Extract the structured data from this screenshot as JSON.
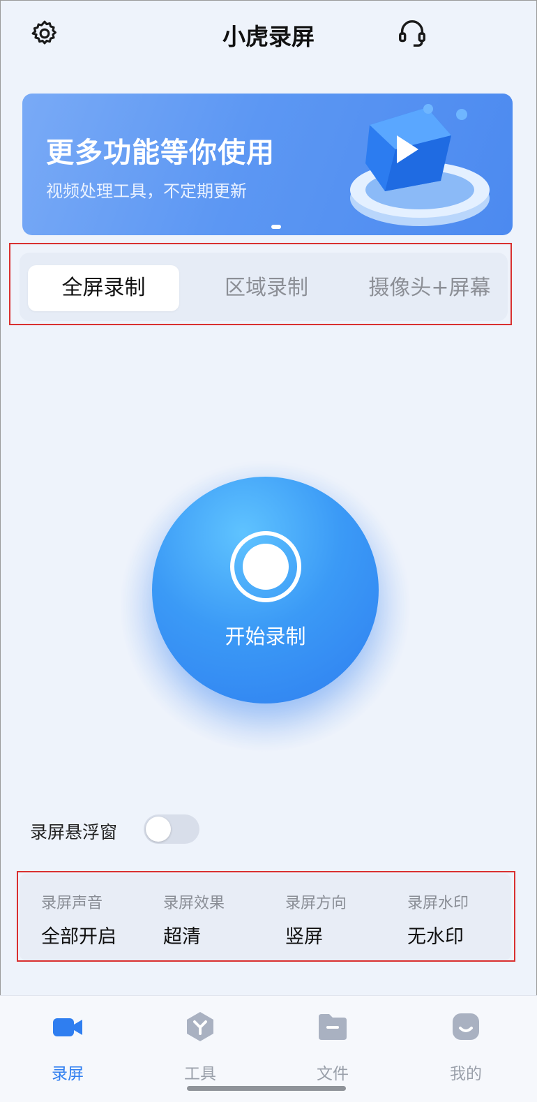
{
  "header": {
    "title": "小虎录屏",
    "icons": [
      "gear-icon",
      "headset-icon"
    ]
  },
  "banner": {
    "title": "更多功能等你使用",
    "subtitle": "视频处理工具，不定期更新",
    "icon": "play-cube-icon"
  },
  "tabs": [
    {
      "label": "全屏录制",
      "active": true
    },
    {
      "label": "区域录制",
      "active": false
    },
    {
      "label": "摄像头+屏幕",
      "active": false
    }
  ],
  "record": {
    "label": "开始录制",
    "icon": "record-icon"
  },
  "floating_window": {
    "label": "录屏悬浮窗",
    "enabled": false
  },
  "settings": [
    {
      "label": "录屏声音",
      "value": "全部开启"
    },
    {
      "label": "录屏效果",
      "value": "超清"
    },
    {
      "label": "录屏方向",
      "value": "竖屏"
    },
    {
      "label": "录屏水印",
      "value": "无水印"
    }
  ],
  "nav": [
    {
      "label": "录屏",
      "icon": "video-camera-icon",
      "active": true
    },
    {
      "label": "工具",
      "icon": "toolbox-icon",
      "active": false
    },
    {
      "label": "文件",
      "icon": "folder-icon",
      "active": false
    },
    {
      "label": "我的",
      "icon": "profile-icon",
      "active": false
    }
  ],
  "colors": {
    "accent": "#2f7ef0",
    "background": "#eef3fb",
    "highlight_box": "#d93030"
  }
}
